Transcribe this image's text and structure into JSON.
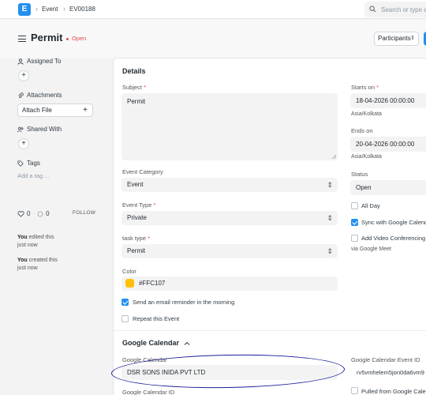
{
  "nav": {
    "logo_letter": "E",
    "crumbs": [
      "Event",
      "EV00188"
    ],
    "search_placeholder": "Search or type a"
  },
  "page": {
    "title": "Permit",
    "status": "Open",
    "participants_label": "Participants"
  },
  "sidebar": {
    "assigned_to": "Assigned To",
    "attachments": "Attachments",
    "attach_file": "Attach File",
    "shared_with": "Shared With",
    "tags": "Tags",
    "add_tag": "Add a tag ...",
    "likes": "0",
    "comments": "0",
    "follow": "FOLLOW",
    "activity": [
      {
        "who": "You",
        "what": "edited this",
        "when": "just now"
      },
      {
        "who": "You",
        "what": "created this",
        "when": "just now"
      }
    ]
  },
  "details": {
    "section_title": "Details",
    "subject_label": "Subject",
    "subject_value": "Permit",
    "category_label": "Event Category",
    "category_value": "Event",
    "type_label": "Event Type",
    "type_value": "Private",
    "task_label": "task type",
    "task_value": "Permit",
    "color_label": "Color",
    "color_value": "#FFC107",
    "color_hex": "#FFC107",
    "email_reminder_label": "Send an email reminder in the morning",
    "repeat_label": "Repeat this Event",
    "starts_label": "Starts on",
    "starts_value": "18-04-2026 00:00:00",
    "starts_tz": "Asia/Kolkata",
    "ends_label": "Ends on",
    "ends_value": "20-04-2026 00:00:00",
    "ends_tz": "Asia/Kolkata",
    "status_label": "Status",
    "status_value": "Open",
    "all_day_label": "All Day",
    "sync_label": "Sync with Google Calenda",
    "video_label": "Add Video Conferencing",
    "video_hint": "via Google Meet"
  },
  "google": {
    "section_title": "Google Calendar",
    "calendar_label": "Google Calendar",
    "calendar_value": "DSR SONS INIDA PVT LTD",
    "event_id_label": "Google Calendar Event ID",
    "event_id_value": "rv5vmhelem5jon0da6vm9",
    "calendar_id_label": "Google Calendar ID",
    "pulled_label": "Pulled from Google Calend"
  },
  "colors": {
    "accent": "#2490ef",
    "status_red": "#e24c4c",
    "annotation": "#1d1f9a"
  }
}
